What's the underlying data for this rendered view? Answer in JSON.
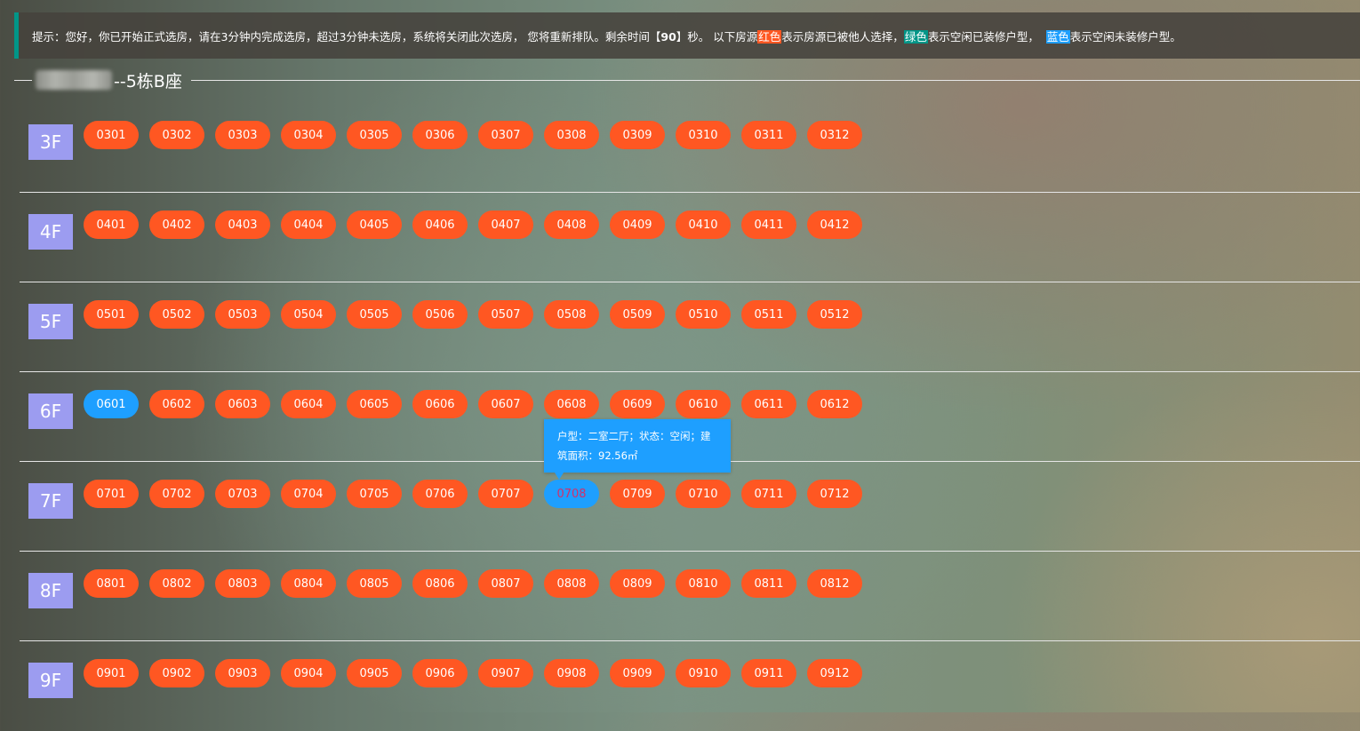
{
  "notice": {
    "part1": "提示：您好，你已开始正式选房，请在3分钟内完成选房，超过3分钟未选房，系统将关闭此次选房，  您将重新排队。剩余时间【",
    "seconds": "90",
    "part2": "】秒。 以下房源",
    "red_word": "红色",
    "part3": "表示房源已被他人选择，",
    "green_word": "绿色",
    "part4": "表示空闲已装修户型，  ",
    "blue_word": "蓝色",
    "part5": "表示空闲未装修户型。"
  },
  "building": {
    "title": "--5栋B座"
  },
  "colors": {
    "sold": "#ff5722",
    "vacant_unfinished": "#1e9fff",
    "vacant_finished": "#009688",
    "floor_label": "#9c9cf0"
  },
  "floors": [
    {
      "label": "3F",
      "rooms": [
        {
          "number": "0301",
          "status": "sold"
        },
        {
          "number": "0302",
          "status": "sold"
        },
        {
          "number": "0303",
          "status": "sold"
        },
        {
          "number": "0304",
          "status": "sold"
        },
        {
          "number": "0305",
          "status": "sold"
        },
        {
          "number": "0306",
          "status": "sold"
        },
        {
          "number": "0307",
          "status": "sold"
        },
        {
          "number": "0308",
          "status": "sold"
        },
        {
          "number": "0309",
          "status": "sold"
        },
        {
          "number": "0310",
          "status": "sold"
        },
        {
          "number": "0311",
          "status": "sold"
        },
        {
          "number": "0312",
          "status": "sold"
        }
      ]
    },
    {
      "label": "4F",
      "rooms": [
        {
          "number": "0401",
          "status": "sold"
        },
        {
          "number": "0402",
          "status": "sold"
        },
        {
          "number": "0403",
          "status": "sold"
        },
        {
          "number": "0404",
          "status": "sold"
        },
        {
          "number": "0405",
          "status": "sold"
        },
        {
          "number": "0406",
          "status": "sold"
        },
        {
          "number": "0407",
          "status": "sold"
        },
        {
          "number": "0408",
          "status": "sold"
        },
        {
          "number": "0409",
          "status": "sold"
        },
        {
          "number": "0410",
          "status": "sold"
        },
        {
          "number": "0411",
          "status": "sold"
        },
        {
          "number": "0412",
          "status": "sold"
        }
      ]
    },
    {
      "label": "5F",
      "rooms": [
        {
          "number": "0501",
          "status": "sold"
        },
        {
          "number": "0502",
          "status": "sold"
        },
        {
          "number": "0503",
          "status": "sold"
        },
        {
          "number": "0504",
          "status": "sold"
        },
        {
          "number": "0505",
          "status": "sold"
        },
        {
          "number": "0506",
          "status": "sold"
        },
        {
          "number": "0507",
          "status": "sold"
        },
        {
          "number": "0508",
          "status": "sold"
        },
        {
          "number": "0509",
          "status": "sold"
        },
        {
          "number": "0510",
          "status": "sold"
        },
        {
          "number": "0511",
          "status": "sold"
        },
        {
          "number": "0512",
          "status": "sold"
        }
      ]
    },
    {
      "label": "6F",
      "rooms": [
        {
          "number": "0601",
          "status": "vacant_unfinished"
        },
        {
          "number": "0602",
          "status": "sold"
        },
        {
          "number": "0603",
          "status": "sold"
        },
        {
          "number": "0604",
          "status": "sold"
        },
        {
          "number": "0605",
          "status": "sold"
        },
        {
          "number": "0606",
          "status": "sold"
        },
        {
          "number": "0607",
          "status": "sold"
        },
        {
          "number": "0608",
          "status": "sold"
        },
        {
          "number": "0609",
          "status": "sold"
        },
        {
          "number": "0610",
          "status": "sold"
        },
        {
          "number": "0611",
          "status": "sold"
        },
        {
          "number": "0612",
          "status": "sold"
        }
      ]
    },
    {
      "label": "7F",
      "rooms": [
        {
          "number": "0701",
          "status": "sold"
        },
        {
          "number": "0702",
          "status": "sold"
        },
        {
          "number": "0703",
          "status": "sold"
        },
        {
          "number": "0704",
          "status": "sold"
        },
        {
          "number": "0705",
          "status": "sold"
        },
        {
          "number": "0706",
          "status": "sold"
        },
        {
          "number": "0707",
          "status": "sold"
        },
        {
          "number": "0708",
          "status": "vacant_unfinished",
          "hovered": true
        },
        {
          "number": "0709",
          "status": "sold"
        },
        {
          "number": "0710",
          "status": "sold"
        },
        {
          "number": "0711",
          "status": "sold"
        },
        {
          "number": "0712",
          "status": "sold"
        }
      ]
    },
    {
      "label": "8F",
      "rooms": [
        {
          "number": "0801",
          "status": "sold"
        },
        {
          "number": "0802",
          "status": "sold"
        },
        {
          "number": "0803",
          "status": "sold"
        },
        {
          "number": "0804",
          "status": "sold"
        },
        {
          "number": "0805",
          "status": "sold"
        },
        {
          "number": "0806",
          "status": "sold"
        },
        {
          "number": "0807",
          "status": "sold"
        },
        {
          "number": "0808",
          "status": "sold"
        },
        {
          "number": "0809",
          "status": "sold"
        },
        {
          "number": "0810",
          "status": "sold"
        },
        {
          "number": "0811",
          "status": "sold"
        },
        {
          "number": "0812",
          "status": "sold"
        }
      ]
    },
    {
      "label": "9F",
      "rooms": [
        {
          "number": "0901",
          "status": "sold"
        },
        {
          "number": "0902",
          "status": "sold"
        },
        {
          "number": "0903",
          "status": "sold"
        },
        {
          "number": "0904",
          "status": "sold"
        },
        {
          "number": "0905",
          "status": "sold"
        },
        {
          "number": "0906",
          "status": "sold"
        },
        {
          "number": "0907",
          "status": "sold"
        },
        {
          "number": "0908",
          "status": "sold"
        },
        {
          "number": "0909",
          "status": "sold"
        },
        {
          "number": "0910",
          "status": "sold"
        },
        {
          "number": "0911",
          "status": "sold"
        },
        {
          "number": "0912",
          "status": "sold"
        }
      ]
    }
  ],
  "tooltip": {
    "line1": "户型：二室二厅；状态：空闲；建",
    "line2": "筑面积：92.56㎡"
  }
}
